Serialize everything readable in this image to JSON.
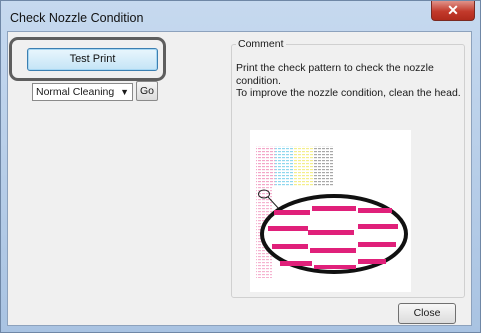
{
  "window": {
    "title": "Check Nozzle Condition",
    "close_icon": "close-icon"
  },
  "controls": {
    "test_print_label": "Test Print",
    "cleaning_select": {
      "selected": "Normal Cleaning",
      "arrow_icon": "chevron-down-icon"
    },
    "go_label": "Go"
  },
  "comment": {
    "label": "Comment",
    "line1": "Print the check pattern to check the nozzle condition.",
    "line2": "To improve the nozzle condition, clean the head."
  },
  "footer": {
    "close_label": "Close"
  },
  "colors": {
    "highlight": "#5e5e5e",
    "pattern_magenta": "#e0207a",
    "pattern_pink": "#f3a6c8",
    "pattern_cyan": "#8fd7ee",
    "pattern_yellow": "#f4ee8c",
    "pattern_gray": "#b5b5b5"
  }
}
